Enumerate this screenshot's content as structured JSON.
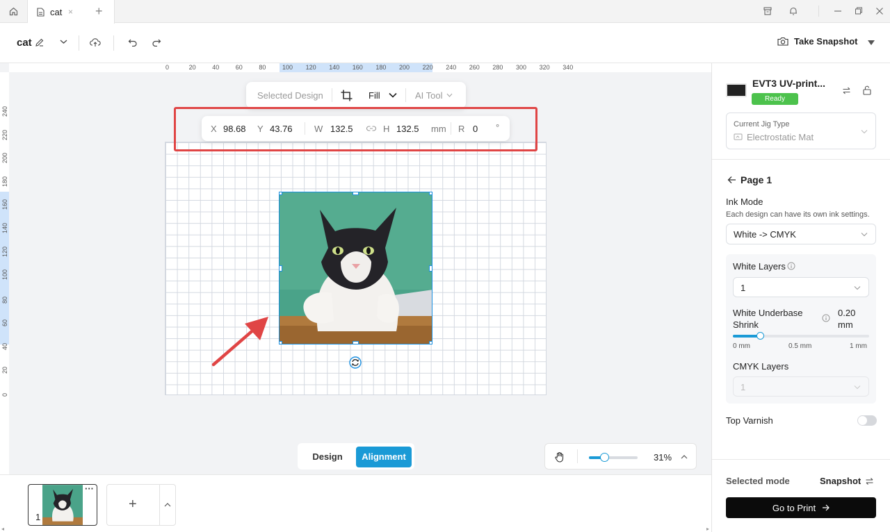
{
  "tabbar": {
    "tab_label": "cat",
    "close_glyph": "×",
    "add_glyph": "+"
  },
  "toolbar": {
    "doc_title": "cat",
    "snapshot_label": "Take Snapshot"
  },
  "ruler": {
    "top_ticks": [
      "0",
      "20",
      "40",
      "60",
      "80",
      "100",
      "120",
      "140",
      "160",
      "180",
      "200",
      "220",
      "240",
      "260",
      "280",
      "300",
      "320",
      "340"
    ],
    "left_ticks": [
      "240",
      "220",
      "200",
      "180",
      "160",
      "140",
      "120",
      "100",
      "80",
      "60",
      "40",
      "20",
      "0"
    ]
  },
  "floatbar": {
    "selected_label": "Selected Design",
    "fill_label": "Fill",
    "ai_label": "AI Tool"
  },
  "position": {
    "x_label": "X",
    "x_value": "98.68",
    "y_label": "Y",
    "y_value": "43.76",
    "w_label": "W",
    "w_value": "132.5",
    "h_label": "H",
    "h_value": "132.5",
    "unit": "mm",
    "r_label": "R",
    "r_value": "0",
    "deg": "°"
  },
  "modes": {
    "design_label": "Design",
    "alignment_label": "Alignment",
    "active": "Alignment"
  },
  "zoom": {
    "value": "31%",
    "level": 0.31
  },
  "thumbs": {
    "page_number": "1",
    "more_glyph": "···",
    "add_glyph": "+"
  },
  "right_panel": {
    "device_name": "EVT3 UV-print...",
    "device_status": "Ready",
    "jig_label": "Current Jig Type",
    "jig_value": "Electrostatic Mat",
    "page_title": "Page 1",
    "ink_mode_label": "Ink Mode",
    "ink_mode_hint": "Each design can have its own ink settings.",
    "ink_mode_value": "White -> CMYK",
    "white_layers_label": "White Layers",
    "white_layers_value": "1",
    "underbase_label_1": "White Underbase",
    "underbase_label_2": "Shrink",
    "underbase_value": "0.20",
    "underbase_unit": "mm",
    "underbase_level": 0.2,
    "slider_min": "0 mm",
    "slider_mid": "0.5 mm",
    "slider_max": "1 mm",
    "cmyk_layers_label": "CMYK Layers",
    "cmyk_layers_value": "1",
    "top_varnish_label": "Top Varnish",
    "top_varnish_on": false,
    "selected_mode_label": "Selected mode",
    "selected_mode_value": "Snapshot",
    "print_label": "Go to Print"
  },
  "colors": {
    "accent": "#1a9ad6",
    "ready_green": "#4cc24c",
    "annotation_red": "#e04545",
    "selection_blue": "#1a8fe0"
  }
}
